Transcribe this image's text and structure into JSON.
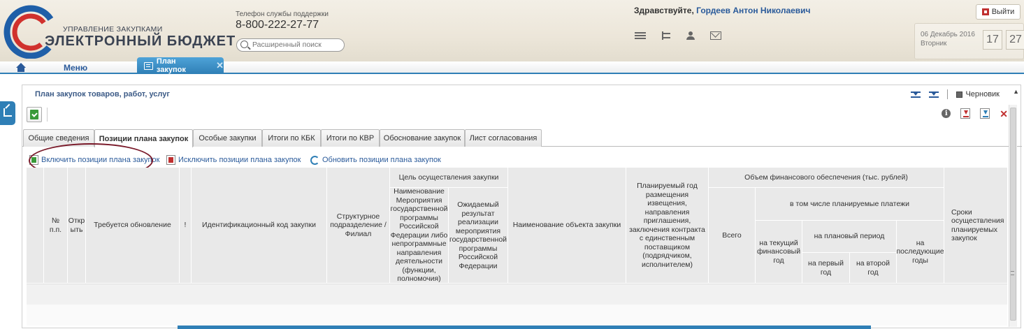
{
  "header": {
    "logo_small": "УПРАВЛЕНИЕ ЗАКУПКАМИ",
    "logo_big": "ЭЛЕКТРОННЫЙ БЮДЖЕТ",
    "support_label": "Телефон службы поддержки",
    "support_phone": "8-800-222-27-77",
    "search_placeholder": "Расширенный поиск",
    "greeting": "Здравствуйте,",
    "user_name": "Гордеев Антон Николаевич",
    "logout_label": "Выйти",
    "date": "06 Декабрь 2016",
    "weekday": "Вторник",
    "clock_hours": "17",
    "clock_minutes": "27"
  },
  "menubar": {
    "menu_label": "Меню",
    "app_tab_label": "План закупок",
    "app_tab_close": "✕"
  },
  "panel": {
    "title": "План закупок товаров, работ, услуг",
    "draft_label": "Черновик",
    "scroll_arrow": "▲"
  },
  "toolbar": {
    "info_glyph": "i",
    "close_glyph": "✕"
  },
  "tabs": [
    {
      "label": "Общие сведения"
    },
    {
      "label": "Позиции плана закупок"
    },
    {
      "label": "Особые закупки"
    },
    {
      "label": "Итоги по КБК"
    },
    {
      "label": "Итоги по КВР"
    },
    {
      "label": "Обоснование закупок"
    },
    {
      "label": "Лист согласования"
    }
  ],
  "actions": {
    "include": "Включить позиции плана закупок",
    "exclude": "Исключить позиции плана закупок",
    "refresh": "Обновить позиции плана закупок"
  },
  "grid": {
    "col_num": "№ п.п.",
    "col_open": "Откр ыть",
    "col_update": "Требуется обновление",
    "col_flag": "!",
    "col_ikz": "Идентификационный код закупки",
    "col_division": "Структурное подразделение / Филиал",
    "col_goal_group": "Цель осуществления закупки",
    "col_goal_program": "Наименование Мероприятия государственной программы Российской Федерации либо непрограммные направления деятельности (функции, полномочия)",
    "col_goal_result": "Ожидаемый результат реализации мероприятия государственной программы Российской Федерации",
    "col_object": "Наименование объекта закупки",
    "col_year": "Планируемый год размещения извещения, направления приглашения, заключения контракта с единственным поставщиком (подрядчиком, исполнителем)",
    "col_finance_group": "Объем финансового обеспечения (тыс. рублей)",
    "col_total": "Всего",
    "col_planned_group": "в том числе планируемые платежи",
    "col_current_year": "на текущий финансовый год",
    "col_plan_period": "на плановый период",
    "col_first_year": "на первый год",
    "col_second_year": "на второй год",
    "col_next_years": "на последующие годы",
    "col_terms": "Сроки осуществления планируемых закупок"
  }
}
